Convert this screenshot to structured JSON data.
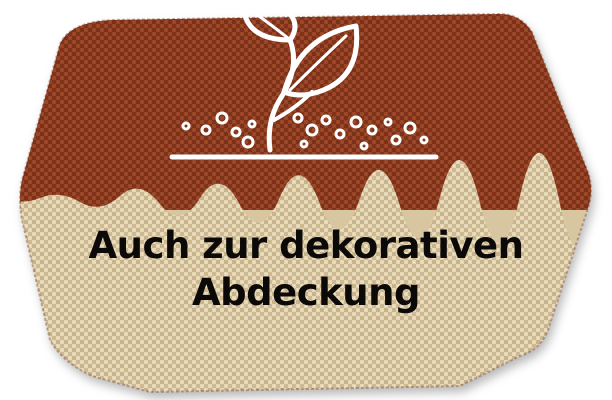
{
  "badge": {
    "caption_line_1": "Auch zur dekorativen",
    "caption_line_2": "Abdeckung",
    "icon": "sprouting-plant-icon",
    "colors": {
      "top_fabric": "#8c3a20",
      "bottom_fabric": "#dccba8",
      "icon_stroke": "#ffffff",
      "text": "#0c0a08"
    }
  }
}
